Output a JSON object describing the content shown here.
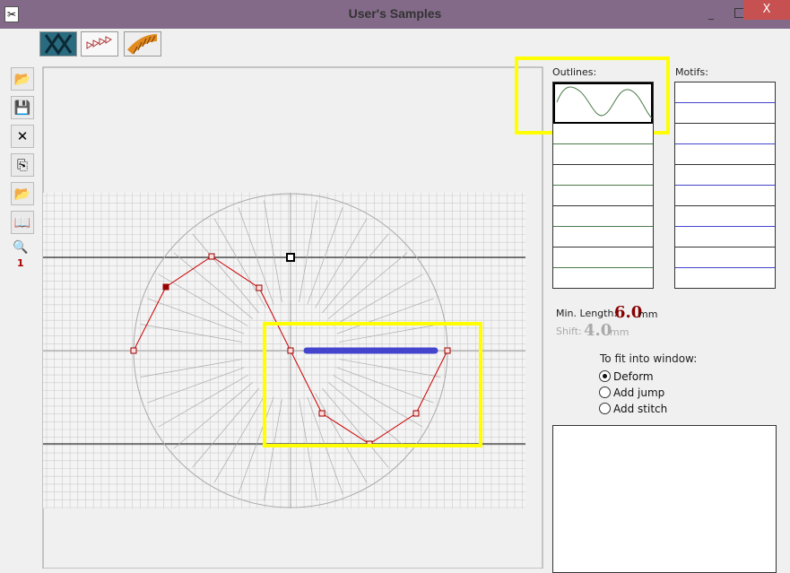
{
  "window": {
    "title": "User's Samples",
    "close": "X"
  },
  "toolbar": {
    "items": [
      "pattern-fill",
      "running-stitch",
      "satin-stitch"
    ]
  },
  "sidebar": {
    "zoom_level": "1"
  },
  "outlines": {
    "label": "Outlines:"
  },
  "motifs": {
    "label": "Motifs:"
  },
  "settings": {
    "min_length_label": "Min. Length:",
    "min_length_value": "6.0",
    "shift_label": "Shift:",
    "shift_value": "4.0",
    "unit": "mm"
  },
  "fit": {
    "label": "To fit into window:",
    "options": [
      "Deform",
      "Add jump",
      "Add stitch"
    ],
    "selected": "Deform"
  },
  "colors": {
    "highlight": "#ffff00",
    "outline": "#cc0000",
    "motif": "#4444cc"
  }
}
